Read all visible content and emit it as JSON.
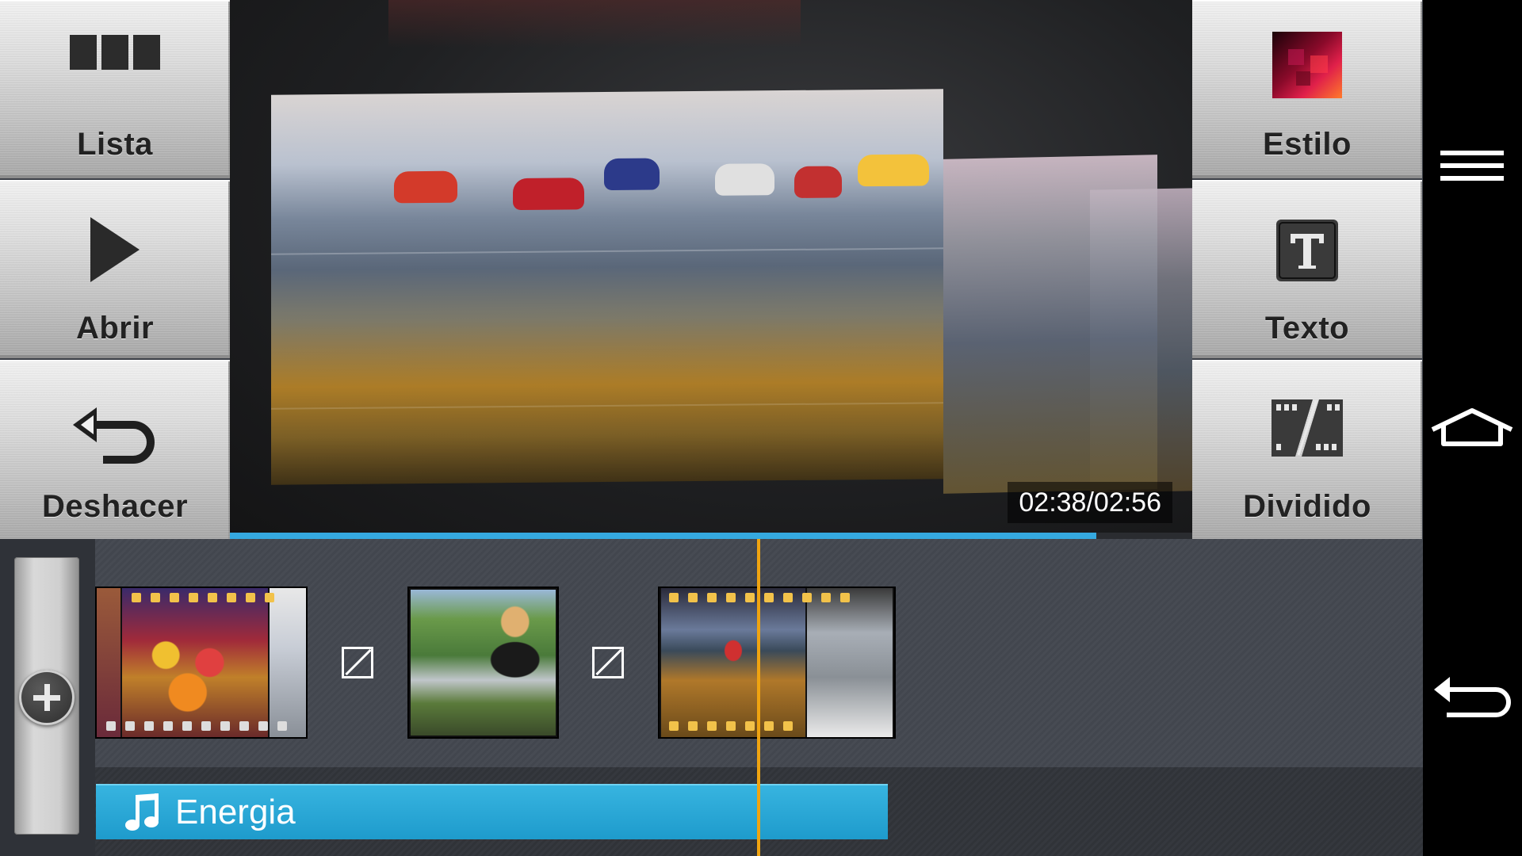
{
  "toolbar_left": {
    "list_label": "Lista",
    "open_label": "Abrir",
    "undo_label": "Deshacer"
  },
  "toolbar_right": {
    "style_label": "Estilo",
    "text_label": "Texto",
    "split_label": "Dividido"
  },
  "preview": {
    "time_readout": "02:38/02:56",
    "progress": 0.9
  },
  "timeline": {
    "music_track_label": "Energia",
    "clips": [
      "clip-1",
      "clip-2",
      "clip-3"
    ]
  },
  "colors": {
    "accent": "#35a9e0",
    "playhead": "#f0a410",
    "music_track": "#1e9bcc"
  },
  "navbar": {
    "icons": [
      "menu-icon",
      "home-icon",
      "back-icon"
    ]
  }
}
